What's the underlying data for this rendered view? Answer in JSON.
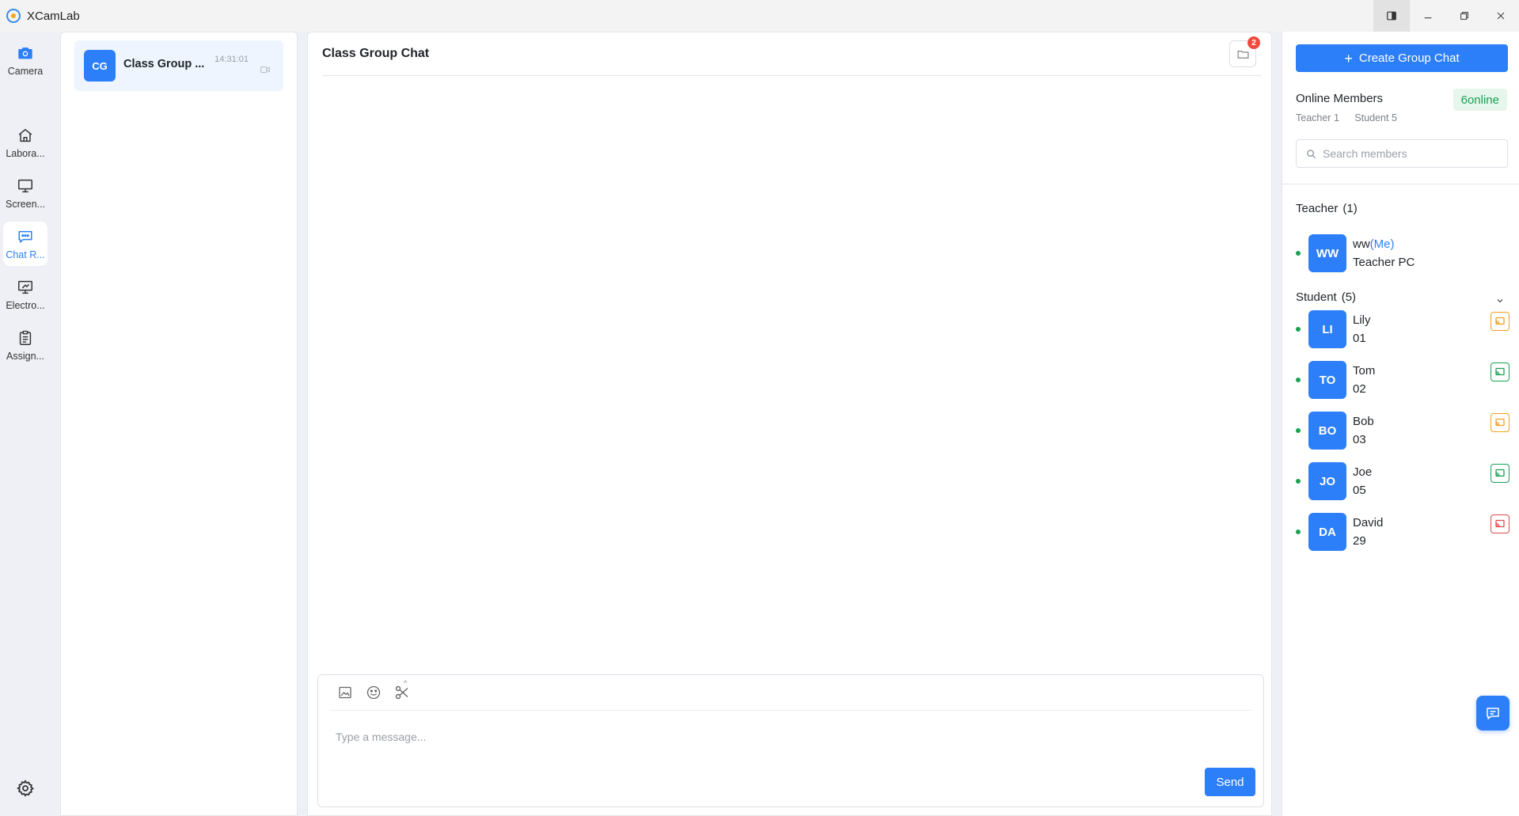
{
  "app": {
    "title": "XCamLab"
  },
  "nav": {
    "items": [
      {
        "label": "Camera",
        "icon": "camera-icon"
      },
      {
        "label": "Labora...",
        "icon": "home-icon"
      },
      {
        "label": "Screen...",
        "icon": "monitor-icon"
      },
      {
        "label": "Chat R...",
        "icon": "chat-icon",
        "active": true
      },
      {
        "label": "Electro...",
        "icon": "whiteboard-icon"
      },
      {
        "label": "Assign...",
        "icon": "clipboard-icon"
      }
    ]
  },
  "conversations": [
    {
      "avatar": "CG",
      "name": "Class Group ...",
      "time": "14:31:01"
    }
  ],
  "chat": {
    "title": "Class Group Chat",
    "file_badge": "2",
    "input_placeholder": "Type a message...",
    "send_label": "Send"
  },
  "members_panel": {
    "create_label": "Create Group Chat",
    "online_title": "Online Members",
    "online_badge": "6online",
    "teacher_count_text": "Teacher 1",
    "student_count_text": "Student 5",
    "search_placeholder": "Search members",
    "teacher_group": {
      "label": "Teacher",
      "count": "(1)"
    },
    "student_group": {
      "label": "Student",
      "count": "(5)"
    },
    "teacher": {
      "avatar": "WW",
      "name": "ww",
      "me_tag": "(Me)",
      "sub": "Teacher PC"
    },
    "students": [
      {
        "avatar": "LI",
        "name": "Lily",
        "sub": "01",
        "status_color": "#f0a020"
      },
      {
        "avatar": "TO",
        "name": "Tom",
        "sub": "02",
        "status_color": "#1aa053"
      },
      {
        "avatar": "BO",
        "name": "Bob",
        "sub": "03",
        "status_color": "#f0a020"
      },
      {
        "avatar": "JO",
        "name": "Joe",
        "sub": "05",
        "status_color": "#1aa053"
      },
      {
        "avatar": "DA",
        "name": "David",
        "sub": "29",
        "status_color": "#e5484d"
      }
    ]
  },
  "colors": {
    "accent": "#2d7ff9",
    "online": "#1aa053",
    "badge": "#f04a3e"
  }
}
